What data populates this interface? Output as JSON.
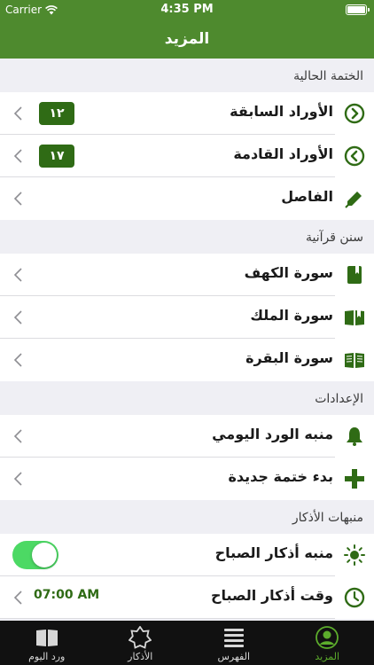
{
  "status_bar": {
    "carrier": "Carrier",
    "time": "4:35 PM"
  },
  "nav": {
    "title": "المزيد"
  },
  "sections": [
    {
      "header": "الختمة الحالية",
      "rows": [
        {
          "label": "الأوراد السابقة",
          "icon": "circle-arrow-right-icon",
          "badge": "١٢"
        },
        {
          "label": "الأوراد القادمة",
          "icon": "circle-arrow-left-icon",
          "badge": "١٧"
        },
        {
          "label": "الفاصل",
          "icon": "bookmark-tag-icon"
        }
      ]
    },
    {
      "header": "سنن قرآنية",
      "rows": [
        {
          "label": "سورة الكهف",
          "icon": "closed-book-icon"
        },
        {
          "label": "سورة الملك",
          "icon": "open-book-bookmark-icon"
        },
        {
          "label": "سورة البقرة",
          "icon": "open-book-icon"
        }
      ]
    },
    {
      "header": "الإعدادات",
      "rows": [
        {
          "label": "منبه الورد اليومي",
          "icon": "bell-icon"
        },
        {
          "label": "بدء ختمة جديدة",
          "icon": "plus-icon"
        }
      ]
    },
    {
      "header": "منبهات الأذكار",
      "rows": [
        {
          "label": "منبه أذكار الصباح",
          "icon": "sun-icon",
          "toggle_on": true
        },
        {
          "label": "وقت أذكار الصباح",
          "icon": "clock-icon",
          "time": "07:00 AM"
        }
      ]
    }
  ],
  "tabs": [
    {
      "label": "ورد اليوم",
      "icon": "book-icon"
    },
    {
      "label": "الأذكار",
      "icon": "star-icon"
    },
    {
      "label": "الفهرس",
      "icon": "list-icon"
    },
    {
      "label": "المزيد",
      "icon": "user-icon",
      "active": true
    }
  ],
  "colors": {
    "brand_green": "#4e8a2e",
    "icon_green": "#2f6b15",
    "toggle_on": "#4cd964",
    "active_tab": "#5cac2c",
    "tab_bar_bg": "#111111",
    "grouped_bg": "#efeff4"
  }
}
